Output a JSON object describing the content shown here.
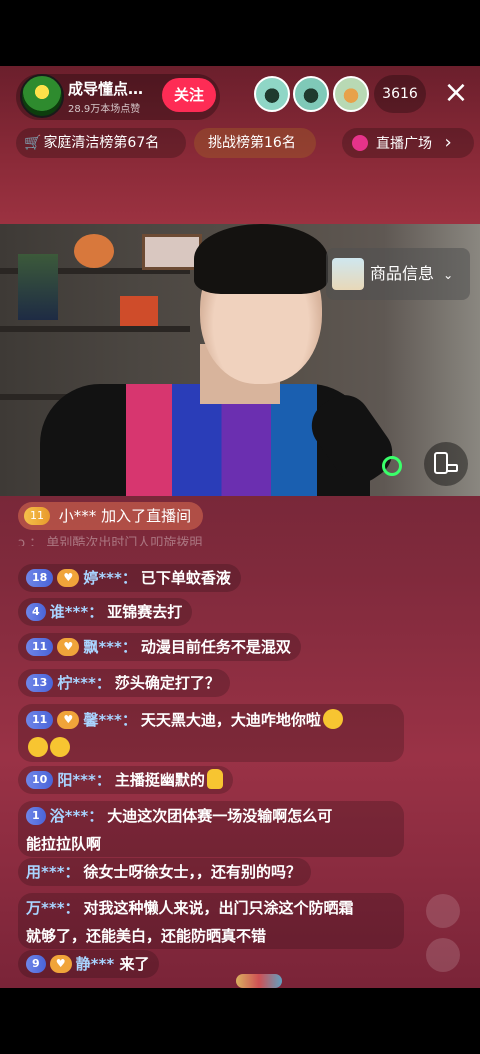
{
  "header": {
    "host_name": "成导懂点…",
    "host_likes": "28.9万本场点赞",
    "follow_label": "关注",
    "viewer_count": "3616",
    "close_label": "×"
  },
  "tags": {
    "rank1": "家庭清洁榜第67名",
    "rank2": "挑战榜第16名",
    "plaza": "直播广场",
    "plaza_arrow": "›"
  },
  "video": {
    "product_label": "商品信息",
    "product_arrow": "⌄"
  },
  "chat": {
    "join": {
      "level": "11",
      "user": "小***",
      "text": "加入了直播间"
    },
    "faded": "ɔ      ：    单别酷次出时门人叩旋拨明",
    "messages": [
      {
        "level": "18",
        "user": "婷***：",
        "text": "已下单蚊香液"
      },
      {
        "level": "4",
        "user": "谁***：",
        "text": "亚锦赛去打"
      },
      {
        "level": "11",
        "user": "飘***：",
        "text": "动漫目前任务不是混双"
      },
      {
        "level": "13",
        "user": "柠***：",
        "text": "莎头确定打了？"
      },
      {
        "level": "11",
        "user": "馨***：",
        "text": "天天黑大迪，大迪咋地你啦"
      },
      {
        "level": "10",
        "user": "阳***：",
        "text": "主播挺幽默的"
      },
      {
        "level": "1",
        "user": "浴***：",
        "text": "大迪这次团体赛一场没输啊怎么可",
        "text2": "能拉拉队啊"
      },
      {
        "user": "用***：",
        "text": "徐女士呀徐女士，，还有别的吗？"
      },
      {
        "user": "万***：",
        "text": "对我这种懒人来说，出门只涂这个防晒霜",
        "text2": "就够了，还能美白，还能防晒真不错"
      },
      {
        "level": "9",
        "user": "静***",
        "text": "来了"
      }
    ]
  },
  "colors": {
    "follow": "#fe2c55",
    "username": "#a9d4ff",
    "level_blue": "#4a64d8",
    "level_gold": "#e89a2c"
  }
}
